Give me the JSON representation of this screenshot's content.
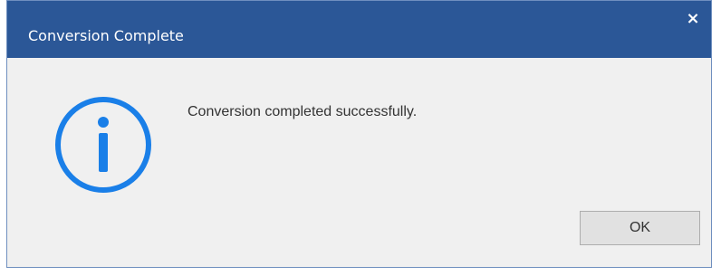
{
  "dialog": {
    "title": "Conversion Complete",
    "close_glyph": "×",
    "icon": "info-icon",
    "message": "Conversion completed successfully.",
    "ok_label": "OK"
  },
  "colors": {
    "titlebar": "#2b5797",
    "title_text": "#ffffff",
    "body_background": "#f0f0f0",
    "icon": "#1a7fe8",
    "button_background": "#e1e1e1",
    "button_border": "#adadad"
  }
}
